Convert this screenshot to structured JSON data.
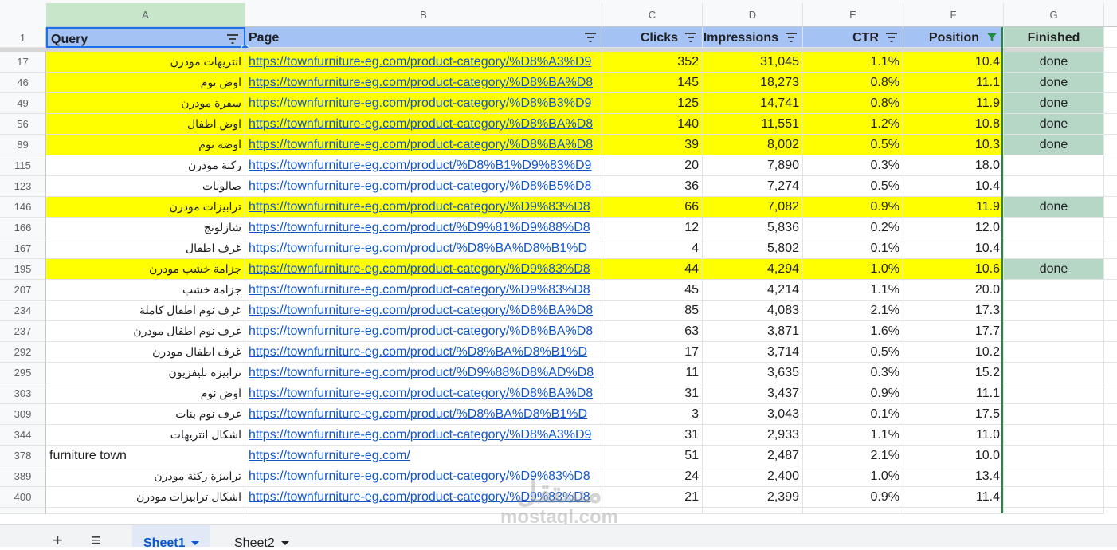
{
  "columns": [
    "A",
    "B",
    "C",
    "D",
    "E",
    "F",
    "G"
  ],
  "header": {
    "row_number": "1",
    "query": "Query",
    "page": "Page",
    "clicks": "Clicks",
    "impressions": "Impressions",
    "ctr": "CTR",
    "position": "Position",
    "finished": "Finished"
  },
  "colors": {
    "highlight": "#ffff00",
    "finished_done": "#b6d7c6",
    "header_blue": "#a4c2f4",
    "link": "#1155cc"
  },
  "rows": [
    {
      "n": "17",
      "query": "انتريهات مودرن",
      "page": "https://townfurniture-eg.com/product-category/%D8%A3%D9",
      "clicks": "352",
      "impressions": "31,045",
      "ctr": "1.1%",
      "position": "10.4",
      "finished": "done",
      "hl": true
    },
    {
      "n": "46",
      "query": "اوض نوم",
      "page": "https://townfurniture-eg.com/product-category/%D8%BA%D8",
      "clicks": "145",
      "impressions": "18,273",
      "ctr": "0.8%",
      "position": "11.1",
      "finished": "done",
      "hl": true
    },
    {
      "n": "49",
      "query": "سفرة مودرن",
      "page": "https://townfurniture-eg.com/product-category/%D8%B3%D9",
      "clicks": "125",
      "impressions": "14,741",
      "ctr": "0.8%",
      "position": "11.9",
      "finished": "done",
      "hl": true
    },
    {
      "n": "56",
      "query": "اوض اطفال",
      "page": "https://townfurniture-eg.com/product-category/%D8%BA%D8",
      "clicks": "140",
      "impressions": "11,551",
      "ctr": "1.2%",
      "position": "10.8",
      "finished": "done",
      "hl": true
    },
    {
      "n": "89",
      "query": "اوضه نوم",
      "page": "https://townfurniture-eg.com/product-category/%D8%BA%D8",
      "clicks": "39",
      "impressions": "8,002",
      "ctr": "0.5%",
      "position": "10.3",
      "finished": "done",
      "hl": true
    },
    {
      "n": "115",
      "query": "ركنة مودرن",
      "page": "https://townfurniture-eg.com/product/%D8%B1%D9%83%D9",
      "clicks": "20",
      "impressions": "7,890",
      "ctr": "0.3%",
      "position": "18.0",
      "finished": "",
      "hl": false
    },
    {
      "n": "123",
      "query": "صالونات",
      "page": "https://townfurniture-eg.com/product-category/%D8%B5%D8",
      "clicks": "36",
      "impressions": "7,274",
      "ctr": "0.5%",
      "position": "10.4",
      "finished": "",
      "hl": false
    },
    {
      "n": "146",
      "query": "ترابيزات مودرن",
      "page": "https://townfurniture-eg.com/product-category/%D9%83%D8",
      "clicks": "66",
      "impressions": "7,082",
      "ctr": "0.9%",
      "position": "11.9",
      "finished": "done",
      "hl": true
    },
    {
      "n": "166",
      "query": "شازلونج",
      "page": "https://townfurniture-eg.com/product/%D9%81%D9%88%D8",
      "clicks": "12",
      "impressions": "5,836",
      "ctr": "0.2%",
      "position": "12.0",
      "finished": "",
      "hl": false
    },
    {
      "n": "167",
      "query": "غرف اطفال",
      "page": "https://townfurniture-eg.com/product/%D8%BA%D8%B1%D",
      "clicks": "4",
      "impressions": "5,802",
      "ctr": "0.1%",
      "position": "10.4",
      "finished": "",
      "hl": false
    },
    {
      "n": "195",
      "query": "جزامة خشب مودرن",
      "page": "https://townfurniture-eg.com/product-category/%D9%83%D8",
      "clicks": "44",
      "impressions": "4,294",
      "ctr": "1.0%",
      "position": "10.6",
      "finished": "done",
      "hl": true
    },
    {
      "n": "207",
      "query": "جزامة خشب",
      "page": "https://townfurniture-eg.com/product-category/%D9%83%D8",
      "clicks": "45",
      "impressions": "4,214",
      "ctr": "1.1%",
      "position": "20.0",
      "finished": "",
      "hl": false
    },
    {
      "n": "234",
      "query": "غرف نوم اطفال كاملة",
      "page": "https://townfurniture-eg.com/product-category/%D8%BA%D8",
      "clicks": "85",
      "impressions": "4,083",
      "ctr": "2.1%",
      "position": "17.3",
      "finished": "",
      "hl": false
    },
    {
      "n": "237",
      "query": "غرف نوم اطفال مودرن",
      "page": "https://townfurniture-eg.com/product-category/%D8%BA%D8",
      "clicks": "63",
      "impressions": "3,871",
      "ctr": "1.6%",
      "position": "17.7",
      "finished": "",
      "hl": false
    },
    {
      "n": "292",
      "query": "غرف اطفال مودرن",
      "page": "https://townfurniture-eg.com/product/%D8%BA%D8%B1%D",
      "clicks": "17",
      "impressions": "3,714",
      "ctr": "0.5%",
      "position": "10.2",
      "finished": "",
      "hl": false
    },
    {
      "n": "295",
      "query": "ترابيزة تليفزيون",
      "page": "https://townfurniture-eg.com/product/%D9%88%D8%AD%D8",
      "clicks": "11",
      "impressions": "3,635",
      "ctr": "0.3%",
      "position": "15.2",
      "finished": "",
      "hl": false
    },
    {
      "n": "303",
      "query": "اوض نوم",
      "page": "https://townfurniture-eg.com/product-category/%D8%BA%D8",
      "clicks": "31",
      "impressions": "3,437",
      "ctr": "0.9%",
      "position": "11.1",
      "finished": "",
      "hl": false
    },
    {
      "n": "309",
      "query": "غرف نوم بنات",
      "page": "https://townfurniture-eg.com/product/%D8%BA%D8%B1%D",
      "clicks": "3",
      "impressions": "3,043",
      "ctr": "0.1%",
      "position": "17.5",
      "finished": "",
      "hl": false
    },
    {
      "n": "344",
      "query": "اشكال انتريهات",
      "page": "https://townfurniture-eg.com/product-category/%D8%A3%D9",
      "clicks": "31",
      "impressions": "2,933",
      "ctr": "1.1%",
      "position": "11.0",
      "finished": "",
      "hl": false
    },
    {
      "n": "378",
      "query": "furniture town",
      "page": "https://townfurniture-eg.com/",
      "clicks": "51",
      "impressions": "2,487",
      "ctr": "2.1%",
      "position": "10.0",
      "finished": "",
      "hl": false,
      "ltr": true
    },
    {
      "n": "389",
      "query": "ترابيزة ركنة مودرن",
      "page": "https://townfurniture-eg.com/product-category/%D9%83%D8",
      "clicks": "24",
      "impressions": "2,400",
      "ctr": "1.0%",
      "position": "13.4",
      "finished": "",
      "hl": false
    },
    {
      "n": "400",
      "query": "اشكال ترابيزات مودرن",
      "page": "https://townfurniture-eg.com/product-category/%D9%83%D8",
      "clicks": "21",
      "impressions": "2,399",
      "ctr": "0.9%",
      "position": "11.4",
      "finished": "",
      "hl": false
    }
  ],
  "sheet_tabs": [
    {
      "label": "Sheet1",
      "active": true
    },
    {
      "label": "Sheet2",
      "active": false
    }
  ],
  "toolbar": {
    "add_sheet": "+",
    "all_sheets": "≡"
  },
  "watermark": {
    "arabic": "مستقل",
    "latin": "mostaql.com"
  }
}
